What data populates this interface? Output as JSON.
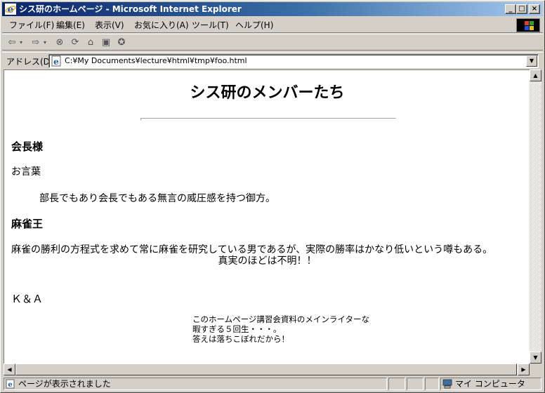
{
  "window": {
    "title": "シス研のホームページ - Microsoft Internet Explorer",
    "min_glyph": "_",
    "max_glyph": "□",
    "close_glyph": "×"
  },
  "menu": [
    "ファイル(F)",
    "編集(E)",
    "表示(V)",
    "お気に入り(A)",
    "ツール(T)",
    "ヘルプ(H)"
  ],
  "address": {
    "label": "アドレス(D)",
    "value": "C:¥My Documents¥lecture¥html¥tmp¥foo.html"
  },
  "page": {
    "heading": "シス研のメンバーたち",
    "section1_title": "会長様",
    "section1_sub": "お言葉",
    "section1_text": "部長でもあり会長でもある無言の威圧感を持つ御方。",
    "section2_title": "麻雀王",
    "section2_line1": "麻雀の勝利の方程式を求めて常に麻雀を研究している男であるが、実際の勝率はかなり低いという噂もある。",
    "section2_line2": "真実のほどは不明！！",
    "section3_title": "Ｋ＆Ａ",
    "section3_line1": "このホームページ講習会資料のメインライターな",
    "section3_line2": "暇すぎる５回生・・・。",
    "section3_line3": "答えは落ちこぼれだから！"
  },
  "status": {
    "text": "ページが表示されました",
    "zone": "マイ コンピュータ"
  }
}
